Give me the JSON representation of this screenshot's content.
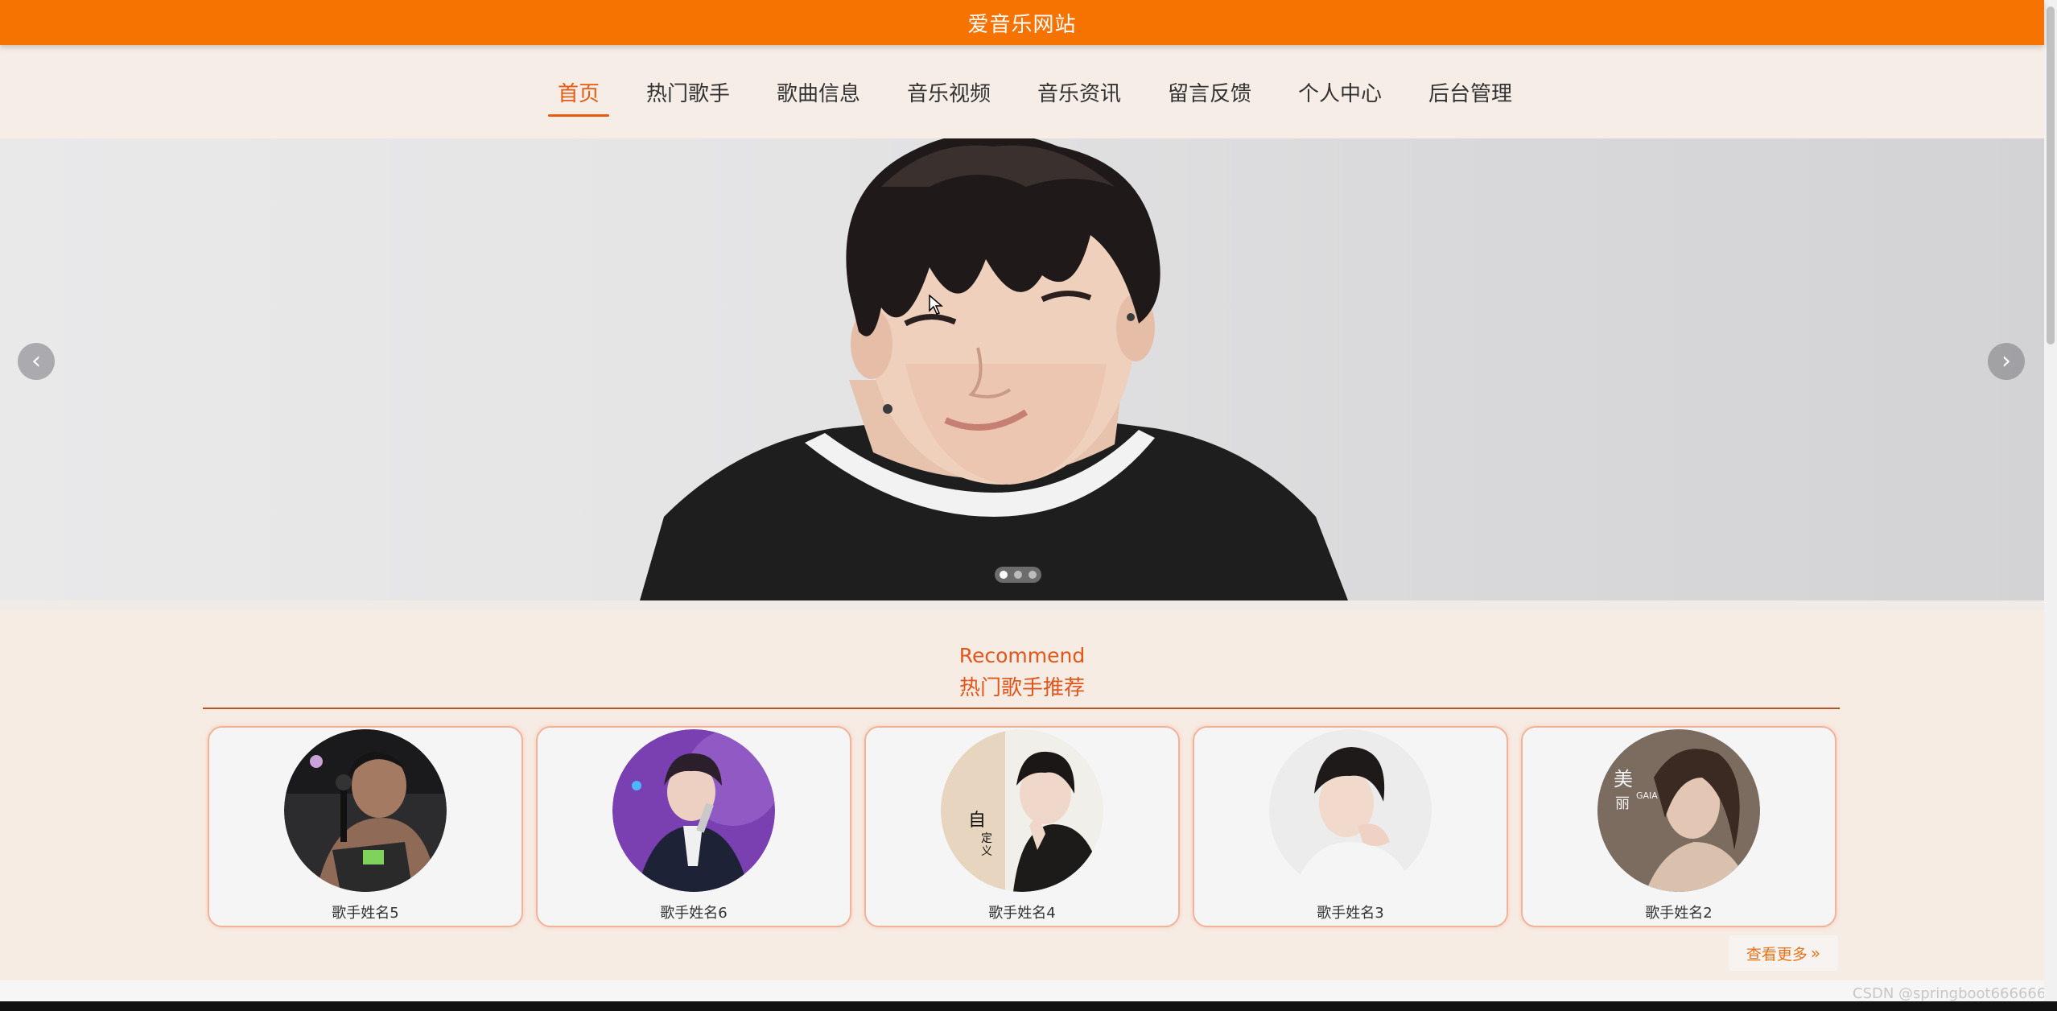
{
  "header": {
    "site_title": "爱音乐网站"
  },
  "nav": {
    "items": [
      {
        "label": "首页",
        "active": true
      },
      {
        "label": "热门歌手",
        "active": false
      },
      {
        "label": "歌曲信息",
        "active": false
      },
      {
        "label": "音乐视频",
        "active": false
      },
      {
        "label": "音乐资讯",
        "active": false
      },
      {
        "label": "留言反馈",
        "active": false
      },
      {
        "label": "个人中心",
        "active": false
      },
      {
        "label": "后台管理",
        "active": false
      }
    ]
  },
  "banner": {
    "prev_icon": "chevron-left-icon",
    "next_icon": "chevron-right-icon",
    "slide_count": 3,
    "active_slide": 1
  },
  "recommend": {
    "title_en": "Recommend",
    "title_zh": "热门歌手推荐",
    "singers": [
      {
        "name": "歌手姓名5"
      },
      {
        "name": "歌手姓名6"
      },
      {
        "name": "歌手姓名4"
      },
      {
        "name": "歌手姓名3"
      },
      {
        "name": "歌手姓名2"
      }
    ],
    "more_label": "查看更多",
    "more_icon": "double-chevron-right-icon"
  },
  "watermark": "CSDN @springboot666666",
  "colors": {
    "brand": "#f67302",
    "accent": "#e0561b",
    "page_bg": "#f6ede6"
  }
}
